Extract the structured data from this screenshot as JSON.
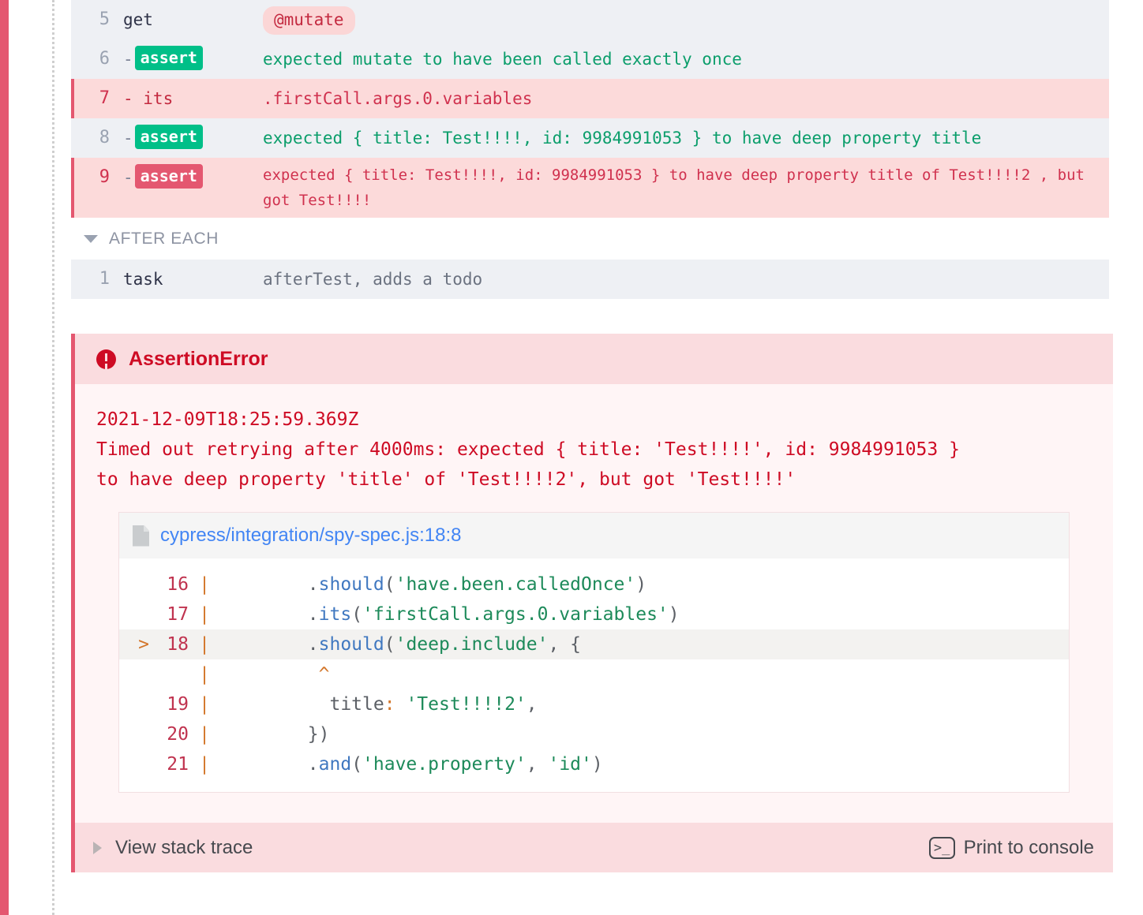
{
  "runner": {
    "edge_color": "#e45770",
    "fail_color": "#e45770",
    "pass_color": "#00bf88"
  },
  "command_log": {
    "rows": [
      {
        "number": "5",
        "name": "get",
        "badge": "",
        "message": "@mutate",
        "style": "alias",
        "state": "alt"
      },
      {
        "number": "6",
        "name": "-",
        "badge": "assert",
        "badge_state": "pass",
        "message": "expected mutate to have been called exactly once",
        "state": "alt"
      },
      {
        "number": "7",
        "name": "- its",
        "badge": "",
        "message": ".firstCall.args.0.variables",
        "state": "fail"
      },
      {
        "number": "8",
        "name": "-",
        "badge": "assert",
        "badge_state": "pass",
        "message": "expected { title: Test!!!!, id: 9984991053 } to have deep property title",
        "state": "alt"
      },
      {
        "number": "9",
        "name": "-",
        "badge": "assert",
        "badge_state": "fail",
        "message": "expected { title: Test!!!!, id: 9984991053 } to have deep property title of Test!!!!2 , but got Test!!!!",
        "state": "fail"
      }
    ],
    "hook": {
      "label": "AFTER EACH",
      "caret": "chevron-down-icon"
    },
    "hook_rows": [
      {
        "number": "1",
        "name": "task",
        "message": "afterTest, adds a todo",
        "state": "alt"
      }
    ]
  },
  "error": {
    "icon": "error-circle-icon",
    "title": "AssertionError",
    "timestamp": "2021-12-09T18:25:59.369Z",
    "message_line1": "Timed out retrying after 4000ms: expected { title: 'Test!!!!', id: 9984991053 }",
    "message_line2": "to have deep property 'title' of 'Test!!!!2', but got 'Test!!!!'",
    "code_frame": {
      "file_icon": "file-icon",
      "file_link": "cypress/integration/spy-spec.js:18:8",
      "lines": [
        {
          "marker": "",
          "number": "16",
          "bar": "|",
          "indent": "        ",
          "code": ".should('have.been.calledOnce')",
          "highlight": false
        },
        {
          "marker": "",
          "number": "17",
          "bar": "|",
          "indent": "        ",
          "code": ".its('firstCall.args.0.variables')",
          "highlight": false
        },
        {
          "marker": ">",
          "number": "18",
          "bar": "|",
          "indent": "        ",
          "code": ".should('deep.include', {",
          "highlight": true
        },
        {
          "marker": "",
          "number": "",
          "bar": "|",
          "indent": "         ",
          "code": "^",
          "highlight": false,
          "caret": true
        },
        {
          "marker": "",
          "number": "19",
          "bar": "|",
          "indent": "          ",
          "code": "title: 'Test!!!!2',",
          "highlight": false
        },
        {
          "marker": "",
          "number": "20",
          "bar": "|",
          "indent": "        ",
          "code": "})",
          "highlight": false
        },
        {
          "marker": "",
          "number": "21",
          "bar": "|",
          "indent": "        ",
          "code": ".and('have.property', 'id')",
          "highlight": false
        }
      ]
    },
    "footer": {
      "stack_trace_label": "View stack trace",
      "stack_trace_caret": "chevron-right-icon",
      "print_console_label": "Print to console",
      "print_console_icon": "terminal-icon",
      "print_console_glyph": ">_"
    }
  }
}
